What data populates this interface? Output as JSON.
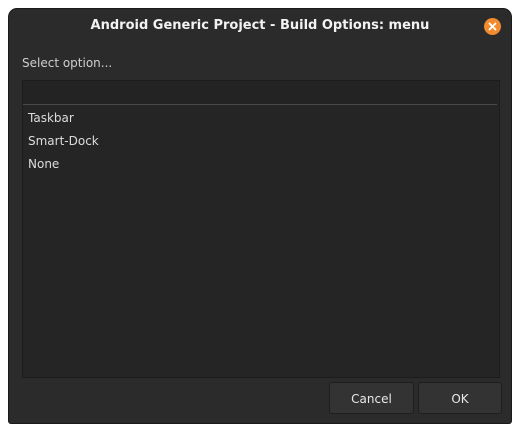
{
  "window": {
    "title": "Android Generic Project - Build Options: menu",
    "close_icon": "close-icon",
    "accent_color": "#f28a2f"
  },
  "prompt": {
    "label": "Select option..."
  },
  "filter": {
    "value": "",
    "placeholder": ""
  },
  "options": [
    {
      "label": "Taskbar"
    },
    {
      "label": "Smart-Dock"
    },
    {
      "label": "None"
    }
  ],
  "buttons": {
    "cancel_label": "Cancel",
    "ok_label": "OK"
  }
}
